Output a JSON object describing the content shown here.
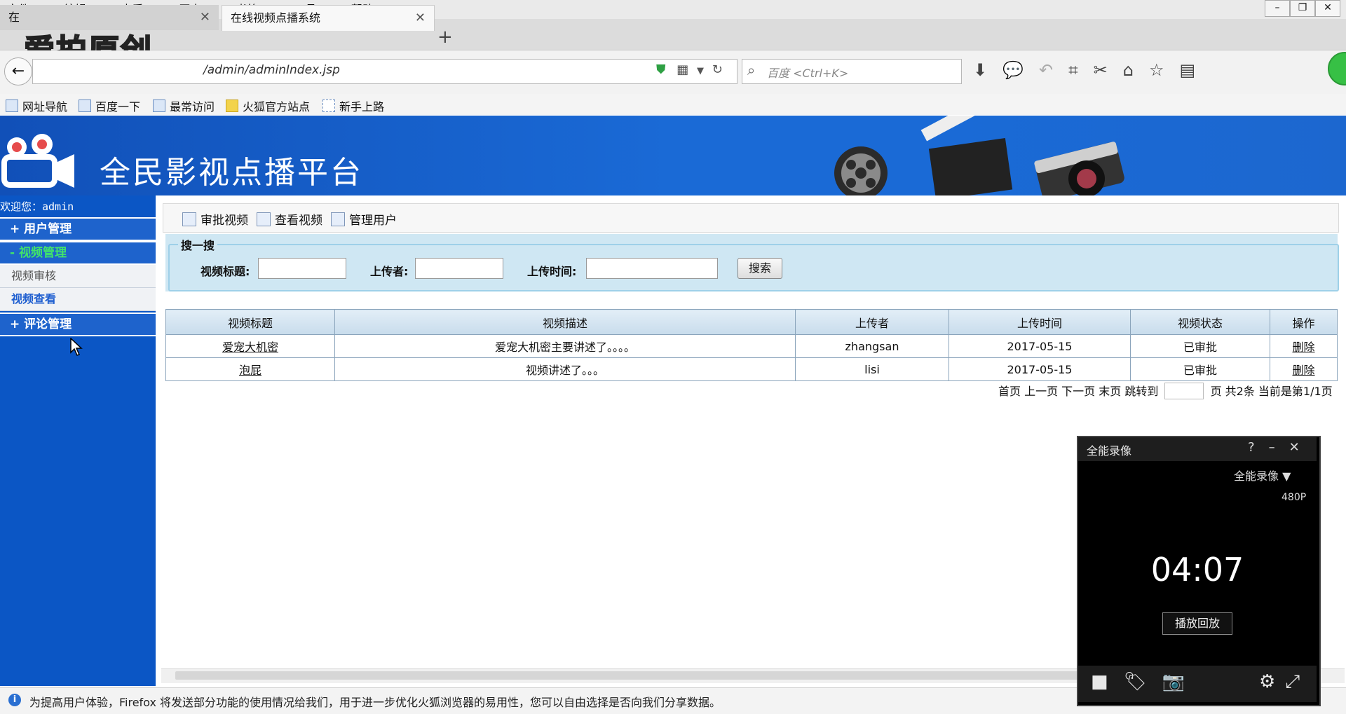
{
  "browser": {
    "menu": [
      "文件(F)",
      "编辑(E)",
      "查看(V)",
      "历史(S)",
      "书签(B)",
      "工具(T)",
      "帮助(H)"
    ],
    "window_controls": [
      "–",
      "❐",
      "✕"
    ],
    "tabs": [
      {
        "label": "在"
      },
      {
        "label": "在线视频点播系统"
      }
    ],
    "tab_close": "✕",
    "new_tab": "+",
    "watermark": "爱拍原创",
    "url": "/admin/adminIndex.jsp",
    "search_placeholder": "百度 <Ctrl+K>",
    "bookmarks": [
      "网址导航",
      "百度一下",
      "最常访问",
      "火狐官方站点",
      "新手上路"
    ]
  },
  "header": {
    "site_title": "全民影视点播平台"
  },
  "sidebar": {
    "welcome": "欢迎您：admin",
    "groups": [
      {
        "label": "+ 用户管理",
        "active": false
      },
      {
        "label": "- 视频管理",
        "active": true
      },
      {
        "label": "+ 评论管理",
        "active": false
      }
    ],
    "subitems": [
      {
        "label": "视频审核",
        "color": "#555555"
      },
      {
        "label": "视频查看",
        "color": "#1f5fd0"
      }
    ]
  },
  "toolbar": {
    "items": [
      "审批视频",
      "查看视频",
      "管理用户"
    ]
  },
  "search": {
    "legend": "搜一搜",
    "title_label": "视频标题:",
    "uploader_label": "上传者:",
    "time_label": "上传时间:",
    "button": "搜索"
  },
  "table": {
    "headers": [
      "视频标题",
      "视频描述",
      "上传者",
      "上传时间",
      "视频状态",
      "操作"
    ],
    "rows": [
      [
        "爱宠大机密",
        "爱宠大机密主要讲述了。。。。",
        "zhangsan",
        "2017-05-15",
        "已审批",
        "删除"
      ],
      [
        "泡屁",
        "视频讲述了。。。",
        "lisi",
        "2017-05-15",
        "已审批",
        "删除"
      ]
    ]
  },
  "pager": {
    "links": "首页 上一页 下一页 末页",
    "jump": "跳转到",
    "summary": "页 共2条 当前是第1/1页"
  },
  "status_bar": {
    "message": "为提高用户体验，Firefox 将发送部分功能的使用情况给我们，用于进一步优化火狐浏览器的易用性，您可以自由选择是否向我们分享数据。"
  },
  "recorder": {
    "title": "全能录像",
    "controls": [
      "?",
      "–",
      "✕"
    ],
    "mode": "全能录像 ▼",
    "resolution": "480P",
    "time": "04:07",
    "play_button": "播放回放"
  }
}
